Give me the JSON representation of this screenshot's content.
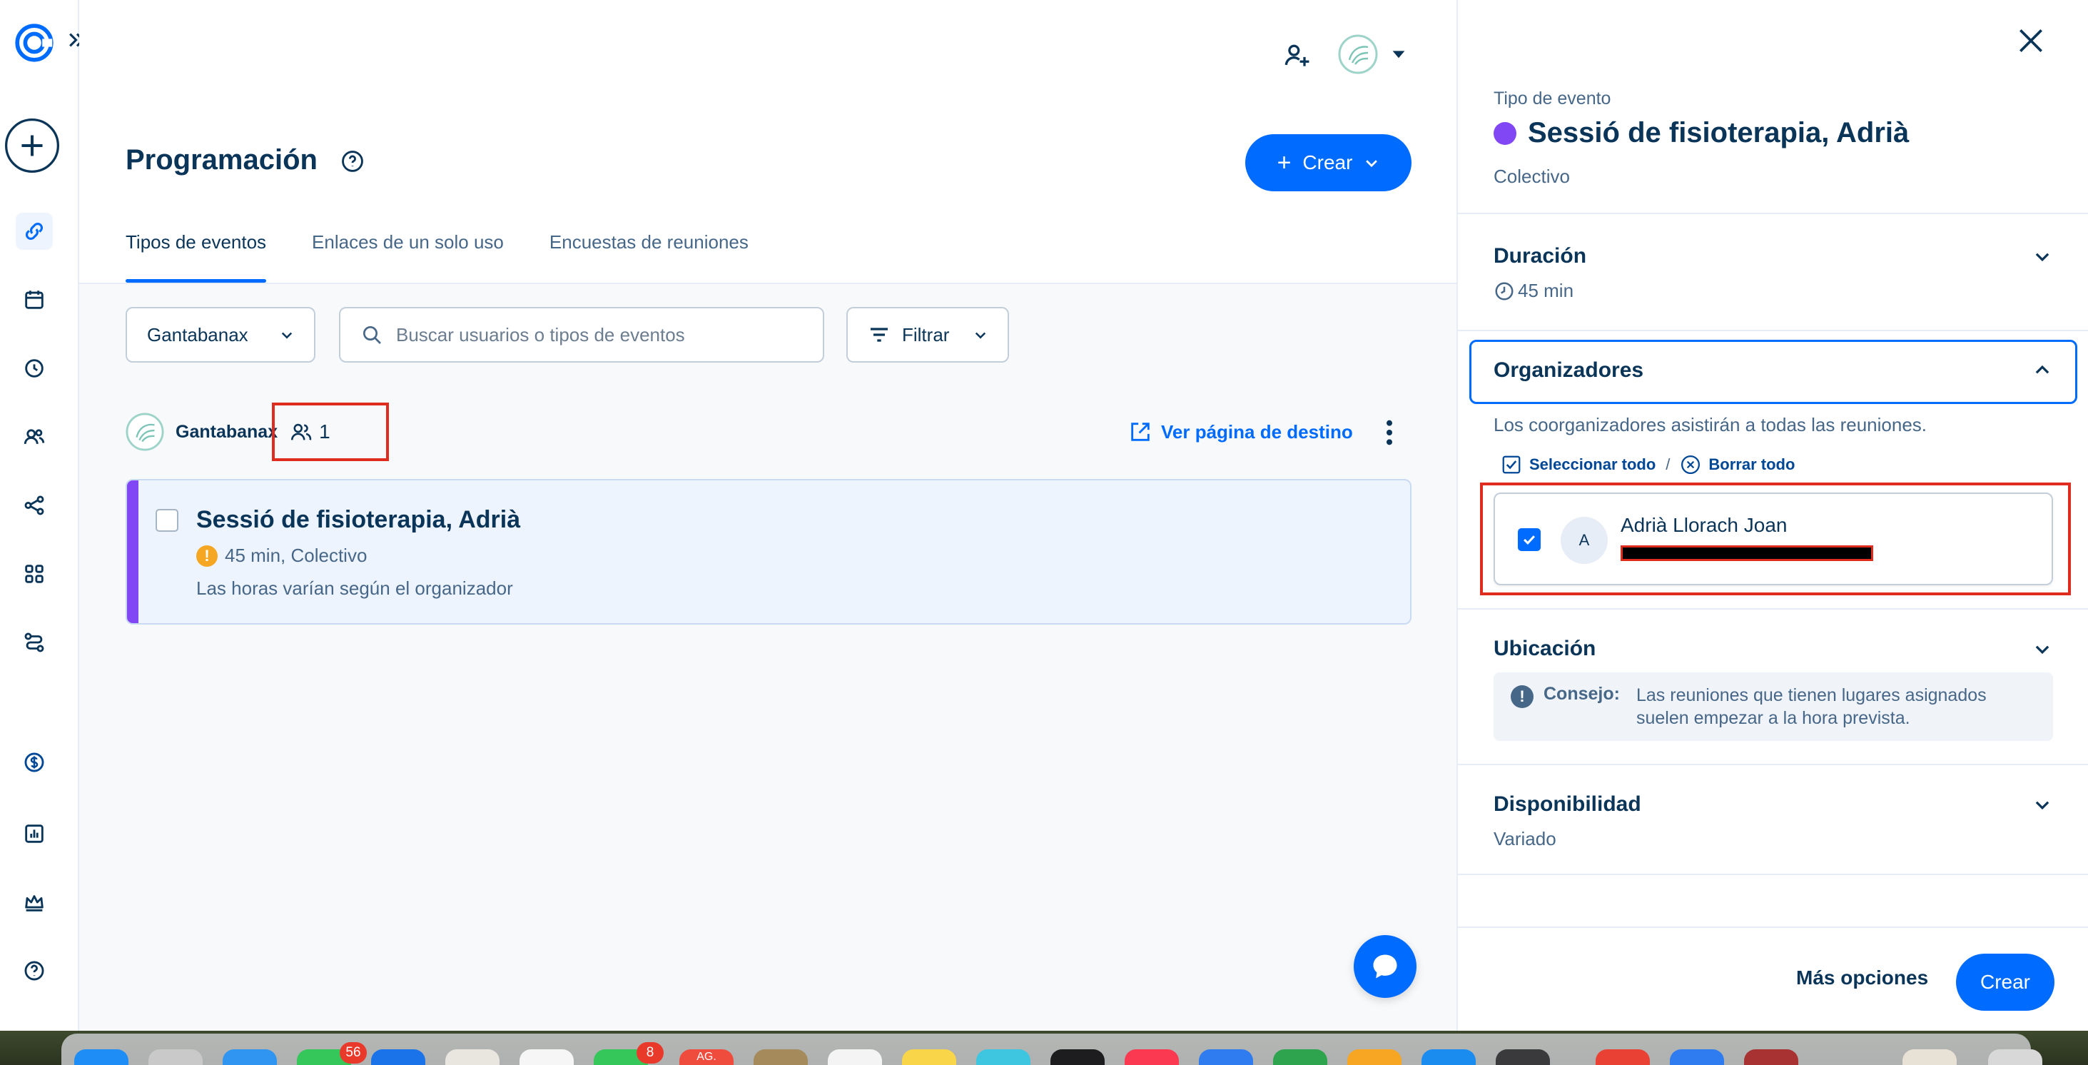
{
  "header": {
    "page_title": "Programación",
    "create_label": "Crear"
  },
  "tabs": [
    {
      "label": "Tipos de eventos"
    },
    {
      "label": "Enlaces de un solo uso"
    },
    {
      "label": "Encuestas de reuniones"
    }
  ],
  "filters": {
    "org_select": "Gantabanax",
    "search_placeholder": "Buscar usuarios o tipos de eventos",
    "filter_label": "Filtrar"
  },
  "owner": {
    "name": "Gantabanax",
    "member_count": "1",
    "landing_link": "Ver página de destino"
  },
  "event": {
    "title": "Sessió de fisioterapia, Adrià",
    "meta": "45 min, Colectivo",
    "description": "Las horas varían según el organizador"
  },
  "panel": {
    "label": "Tipo de evento",
    "title": "Sessió de fisioterapia, Adrià",
    "subtitle": "Colectivo",
    "duration": {
      "title": "Duración",
      "value": "45 min"
    },
    "organizers": {
      "title": "Organizadores",
      "hint": "Los coorganizadores asistirán a todas las reuniones.",
      "select_all": "Seleccionar todo",
      "separator": "/",
      "clear_all": "Borrar todo",
      "host": {
        "initial": "A",
        "name": "Adrià Llorach Joan"
      }
    },
    "location": {
      "title": "Ubicación",
      "tip_label": "Consejo:",
      "tip_text": "Las reuniones que tienen lugares asignados suelen empezar a la hora prevista."
    },
    "availability": {
      "title": "Disponibilidad",
      "value": "Variado"
    },
    "footer": {
      "more_options": "Más opciones",
      "create": "Crear"
    }
  },
  "dock": {
    "badges": [
      "56",
      "8"
    ],
    "calendar_month": "AG."
  },
  "colors": {
    "brand_blue": "#006bff",
    "event_purple": "#8247f5",
    "highlight_red": "#e02b1f"
  }
}
